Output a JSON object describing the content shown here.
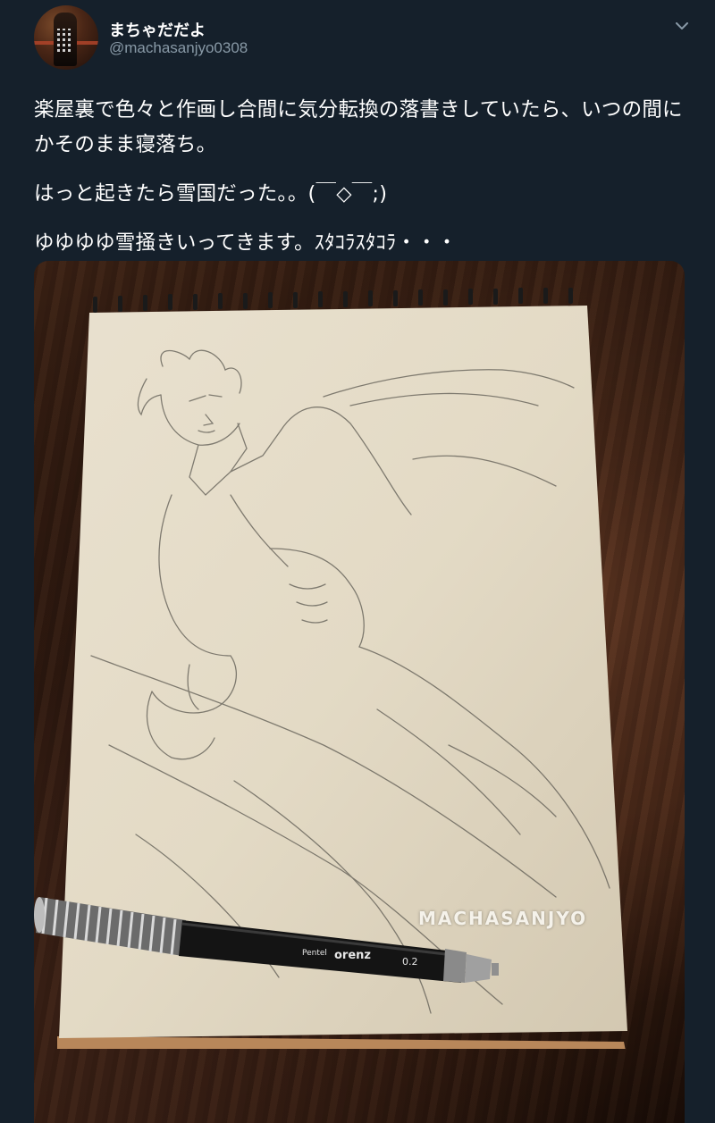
{
  "tweet": {
    "display_name": "まちゃだだよ",
    "handle": "@machasanjyo0308",
    "body_lines": [
      "楽屋裏で色々と作画し合間に気分転換の落書きしていたら、いつの間にかそのまま寝落ち。",
      "はっと起きたら雪国だった。。(￣◇￣;)",
      "ゆゆゆゆ雪掻きいってきます。ｽﾀｺﾗｽﾀｺﾗ・・・"
    ]
  },
  "media": {
    "watermark": "MACHASANJYO",
    "pencil_brand": "Pentel",
    "pencil_model": "orenz",
    "pencil_size": "0.2"
  },
  "icons": {
    "menu": "chevron-down-icon",
    "avatar": "profile-avatar"
  },
  "colors": {
    "background": "#15202b",
    "secondary_text": "#8899a6",
    "primary_text": "#ffffff"
  }
}
